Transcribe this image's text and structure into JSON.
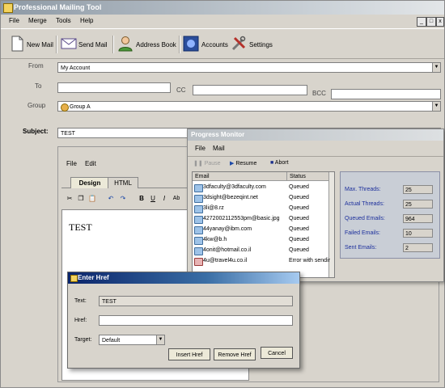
{
  "app": {
    "title": "Professional Mailing Tool"
  },
  "menu": [
    "File",
    "Merge",
    "Tools",
    "Help"
  ],
  "window_buttons": [
    "_",
    "□",
    "x"
  ],
  "toolbar": {
    "new_mail": "New Mail",
    "send_mail": "Send Mail",
    "address_book": "Address Book",
    "accounts": "Accounts",
    "settings": "Settings"
  },
  "form": {
    "from_label": "From",
    "from_value": "My Account",
    "to_label": "To",
    "cc_label": "CC",
    "bcc_label": "BCC",
    "group_label": "Group",
    "group_value": "Group A",
    "subject_label": "Subject:",
    "subject_value": "TEST"
  },
  "editor": {
    "menu": [
      "File",
      "Edit"
    ],
    "tabs": [
      "Design",
      "HTML"
    ],
    "content": "TEST",
    "format_buttons": [
      "B",
      "U",
      "I",
      "Ab"
    ]
  },
  "progress_monitor": {
    "title": "Progress Monitor",
    "menu": [
      "File",
      "Mail"
    ],
    "toolbar": {
      "pause": "Pause",
      "resume": "Resume",
      "abort": "Abort"
    },
    "columns": [
      "Email",
      "Status"
    ],
    "rows": [
      {
        "email": "3dfaculty@3dfaculty.com",
        "status": "Queued"
      },
      {
        "email": "3dsight@bezeqint.net",
        "status": "Queued"
      },
      {
        "email": "3li@8.rz",
        "status": "Queued"
      },
      {
        "email": "4272002112553pm@basic.jpg",
        "status": "Queued"
      },
      {
        "email": "44yanay@ibm.com",
        "status": "Queued"
      },
      {
        "email": "4kw@b.h",
        "status": "Queued"
      },
      {
        "email": "4onit@hotmail.co.il",
        "status": "Queued"
      },
      {
        "email": "4u@travel4u.co.il",
        "status": "Error with sendir"
      }
    ],
    "stats": [
      {
        "label": "Max. Threads:",
        "value": "25"
      },
      {
        "label": "Actual Threads:",
        "value": "25"
      },
      {
        "label": "Queued Emails:",
        "value": "964"
      },
      {
        "label": "Failed Emails:",
        "value": "10"
      },
      {
        "label": "Sent Emails:",
        "value": "2"
      }
    ]
  },
  "href_dialog": {
    "title": "Enter Href",
    "text_label": "Text:",
    "text_value": "TEST",
    "href_label": "Href:",
    "href_value": "",
    "target_label": "Target:",
    "target_value": "Default",
    "insert_button": "Insert Href",
    "remove_button": "Remove Href",
    "cancel_button": "Cancel"
  }
}
